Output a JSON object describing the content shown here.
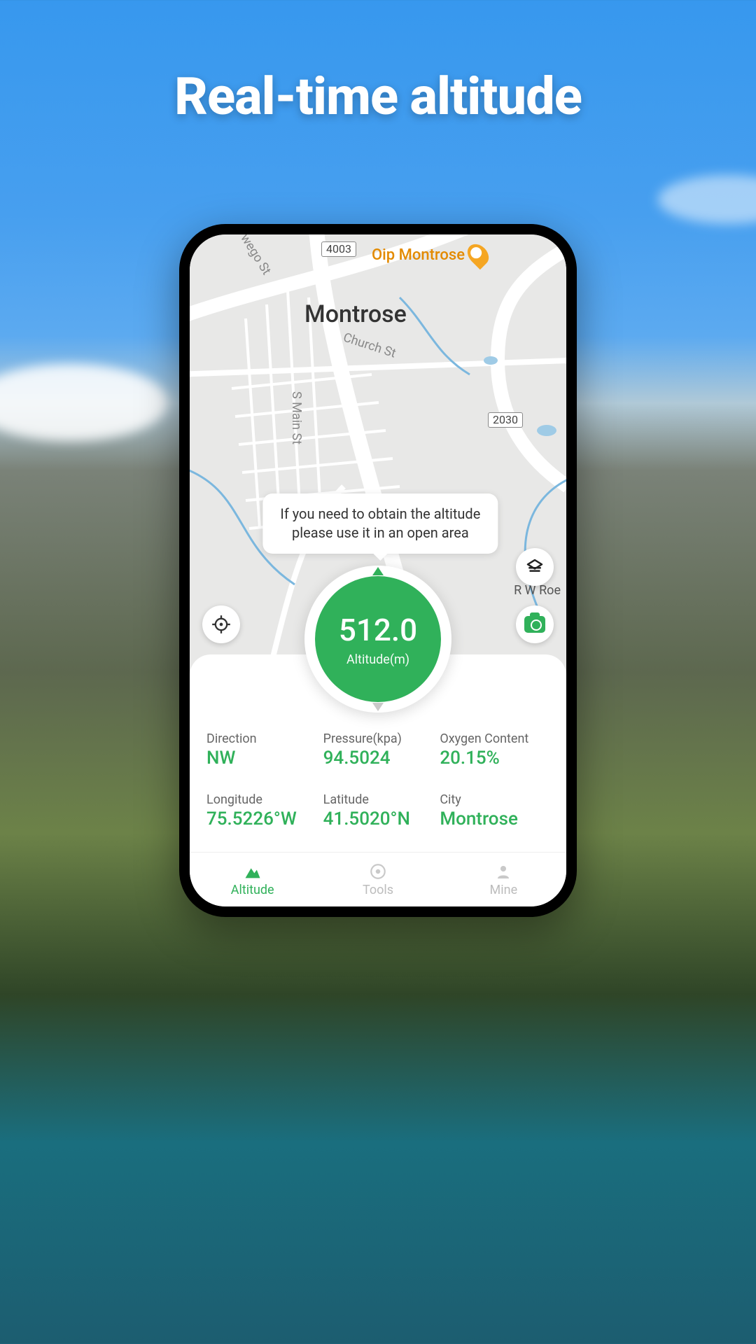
{
  "headline": "Real-time altitude",
  "map": {
    "city": "Montrose",
    "poi": "Oip Montrose",
    "road_4003": "4003",
    "road_2030": "2030",
    "street_church": "Church St",
    "street_smain": "S Main St",
    "street_wego": "wego St",
    "street_rw": "R W Roe"
  },
  "tooltip": {
    "line1": "If you need to obtain the altitude",
    "line2": "please use it in an open area"
  },
  "altitude": {
    "value": "512.0",
    "label": "Altitude(m)"
  },
  "stats": {
    "direction_label": "Direction",
    "direction_value": "NW",
    "pressure_label": "Pressure(kpa)",
    "pressure_value": "94.5024",
    "oxygen_label": "Oxygen Content",
    "oxygen_value": "20.15%",
    "longitude_label": "Longitude",
    "longitude_value": "75.5226°W",
    "latitude_label": "Latitude",
    "latitude_value": "41.5020°N",
    "city_label": "City",
    "city_value": "Montrose"
  },
  "nav": {
    "altitude": "Altitude",
    "tools": "Tools",
    "mine": "Mine"
  },
  "colors": {
    "accent": "#30b15a"
  }
}
